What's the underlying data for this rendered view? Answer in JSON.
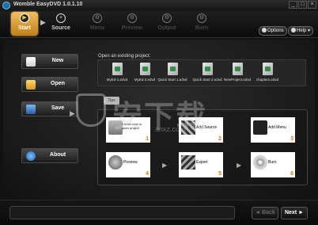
{
  "window": {
    "title": "Womble EasyDVD  1.0.1.10",
    "min_icon": "minimize-icon",
    "max_icon": "maximize-icon",
    "close_icon": "close-icon"
  },
  "steps": [
    {
      "label": "Start",
      "state": "active",
      "icon": "play-icon"
    },
    {
      "label": "Source",
      "state": "done",
      "icon": "plus-icon"
    },
    {
      "label": "Menu",
      "state": "disabled",
      "icon": "gear-icon"
    },
    {
      "label": "Preview",
      "state": "disabled",
      "icon": "gear-icon"
    },
    {
      "label": "Output",
      "state": "disabled",
      "icon": "gear-icon"
    },
    {
      "label": "Burn",
      "state": "disabled",
      "icon": "gear-icon"
    }
  ],
  "toolbar": {
    "options_label": "Options",
    "help_label": "Help"
  },
  "left_buttons": {
    "new_label": "New",
    "open_label": "Open",
    "save_label": "Save",
    "about_label": "About"
  },
  "recent": {
    "header": "Open an existing project:",
    "projects": [
      "MyEd-1.edvd",
      "MyEd-2.edvd",
      "Quick Start 1.edvd",
      "Quick Start 2.edvd",
      "NewProject.edvd",
      "chapters.edvd"
    ]
  },
  "tips_label": "Tips",
  "tasks": [
    {
      "label": "Create new or open project",
      "num": "1",
      "icon": "folder-icon"
    },
    {
      "label": "Add Source",
      "num": "2",
      "icon": "film-icon"
    },
    {
      "label": "Add Menu",
      "num": "3",
      "icon": "menu-icon"
    },
    {
      "label": "Preview",
      "num": "4",
      "icon": "preview-icon"
    },
    {
      "label": "Export",
      "num": "5",
      "icon": "export-icon"
    },
    {
      "label": "Burn",
      "num": "6",
      "icon": "disc-icon"
    }
  ],
  "navigation": {
    "back_label": "◄ Back",
    "next_label": "Next ►"
  },
  "watermark": {
    "text": "安下载",
    "sub": "anxz.com"
  },
  "colors": {
    "accent": "#e0a030",
    "task_number": "#e07000"
  }
}
